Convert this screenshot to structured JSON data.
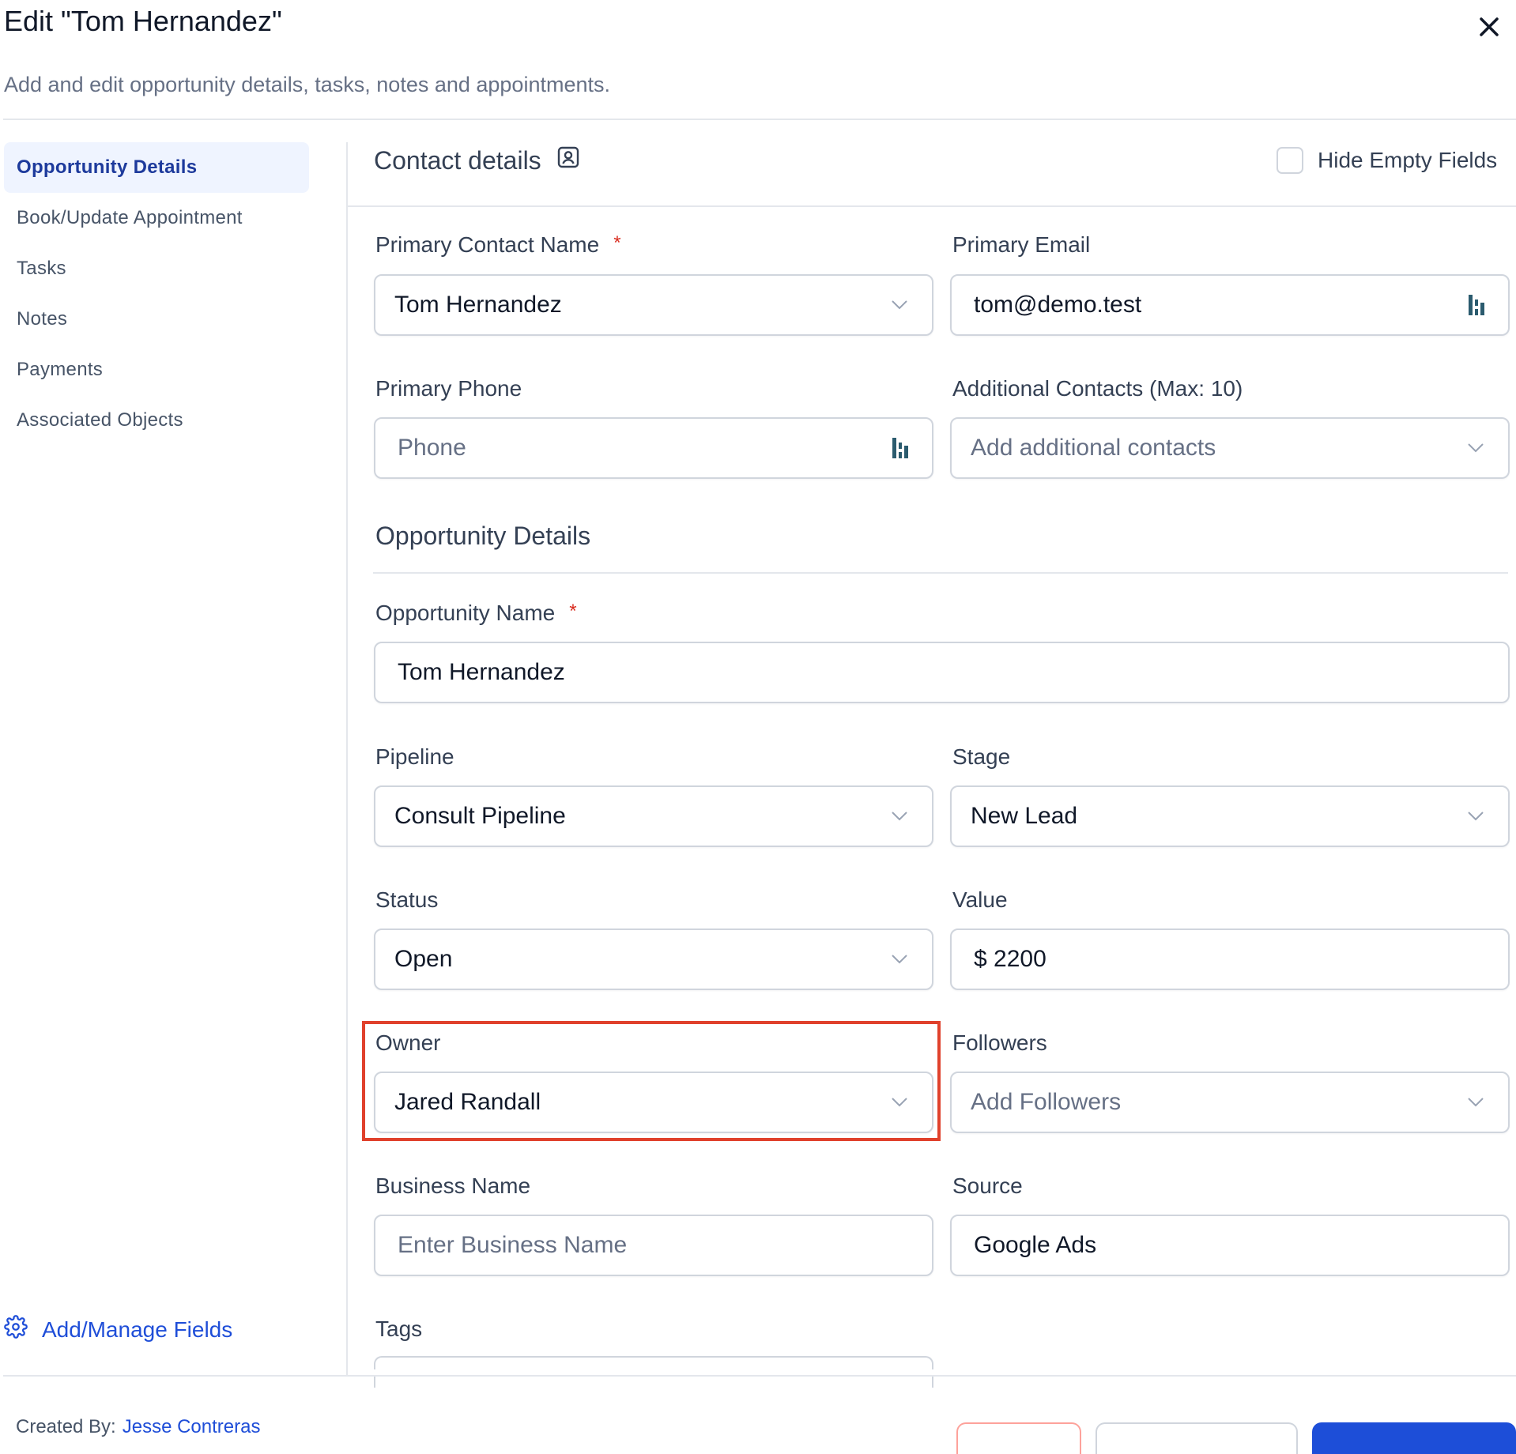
{
  "header": {
    "title": "Edit \"Tom Hernandez\"",
    "subtitle": "Add and edit opportunity details, tasks, notes and appointments."
  },
  "sidebar": {
    "items": [
      {
        "label": "Opportunity Details",
        "active": true
      },
      {
        "label": "Book/Update Appointment"
      },
      {
        "label": "Tasks"
      },
      {
        "label": "Notes"
      },
      {
        "label": "Payments"
      },
      {
        "label": "Associated Objects"
      }
    ],
    "manage_fields": "Add/Manage Fields"
  },
  "contact": {
    "heading": "Contact details",
    "hide_empty": "Hide Empty Fields",
    "primary_contact_label": "Primary Contact Name",
    "primary_contact_value": "Tom Hernandez",
    "primary_email_label": "Primary Email",
    "primary_email_value": "tom@demo.test",
    "primary_phone_label": "Primary Phone",
    "primary_phone_placeholder": "Phone",
    "additional_label": "Additional Contacts (Max: 10)",
    "additional_placeholder": "Add additional contacts",
    "required_mark": "*"
  },
  "opportunity": {
    "heading": "Opportunity Details",
    "name_label": "Opportunity Name",
    "name_value": "Tom Hernandez",
    "pipeline_label": "Pipeline",
    "pipeline_value": "Consult Pipeline",
    "stage_label": "Stage",
    "stage_value": "New Lead",
    "status_label": "Status",
    "status_value": "Open",
    "value_label": "Value",
    "value_value": "$ 2200",
    "owner_label": "Owner",
    "owner_value": "Jared Randall",
    "followers_label": "Followers",
    "followers_placeholder": "Add Followers",
    "business_label": "Business Name",
    "business_placeholder": "Enter Business Name",
    "source_label": "Source",
    "source_value": "Google Ads",
    "tags_label": "Tags"
  },
  "footer": {
    "created_label": "Created By:",
    "created_by": "Jesse Contreras"
  },
  "colors": {
    "accent": "#1d4ed8",
    "highlight": "#e0412c",
    "required": "#d92d20"
  }
}
